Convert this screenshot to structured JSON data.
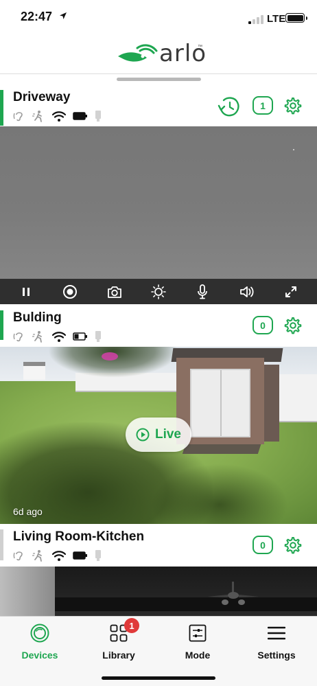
{
  "status_bar": {
    "time": "22:47",
    "carrier": "LTE",
    "signal_bars_active": 1,
    "signal_bars_total": 4,
    "battery_level": 1.0
  },
  "header": {
    "logo_text": "arlo",
    "logo_tm": "™",
    "brand_color": "#1ea650"
  },
  "devices": [
    {
      "name": "Driveway",
      "active": true,
      "count": "1",
      "has_history_icon": true,
      "status_icons": [
        "audio-icon",
        "motion-icon",
        "wifi-icon",
        "battery-icon",
        "signal-bar-icon"
      ]
    },
    {
      "name": "Bulding",
      "active": true,
      "count": "0",
      "live_label": "Live",
      "age": "6d ago",
      "status_icons": [
        "audio-icon",
        "motion-icon",
        "wifi-icon",
        "battery-low-icon",
        "signal-bar-icon"
      ]
    },
    {
      "name": "Living Room-Kitchen",
      "active": false,
      "count": "0",
      "status_icons": [
        "audio-icon",
        "motion-icon",
        "wifi-icon",
        "battery-icon",
        "signal-bar-icon"
      ]
    }
  ],
  "player_controls": [
    "pause-icon",
    "record-icon",
    "snapshot-icon",
    "brightness-icon",
    "microphone-icon",
    "speaker-icon",
    "fullscreen-icon"
  ],
  "tabs": [
    {
      "label": "Devices",
      "icon": "devices-icon",
      "active": true
    },
    {
      "label": "Library",
      "icon": "library-icon",
      "badge": "1"
    },
    {
      "label": "Mode",
      "icon": "mode-icon"
    },
    {
      "label": "Settings",
      "icon": "settings-menu-icon"
    }
  ]
}
